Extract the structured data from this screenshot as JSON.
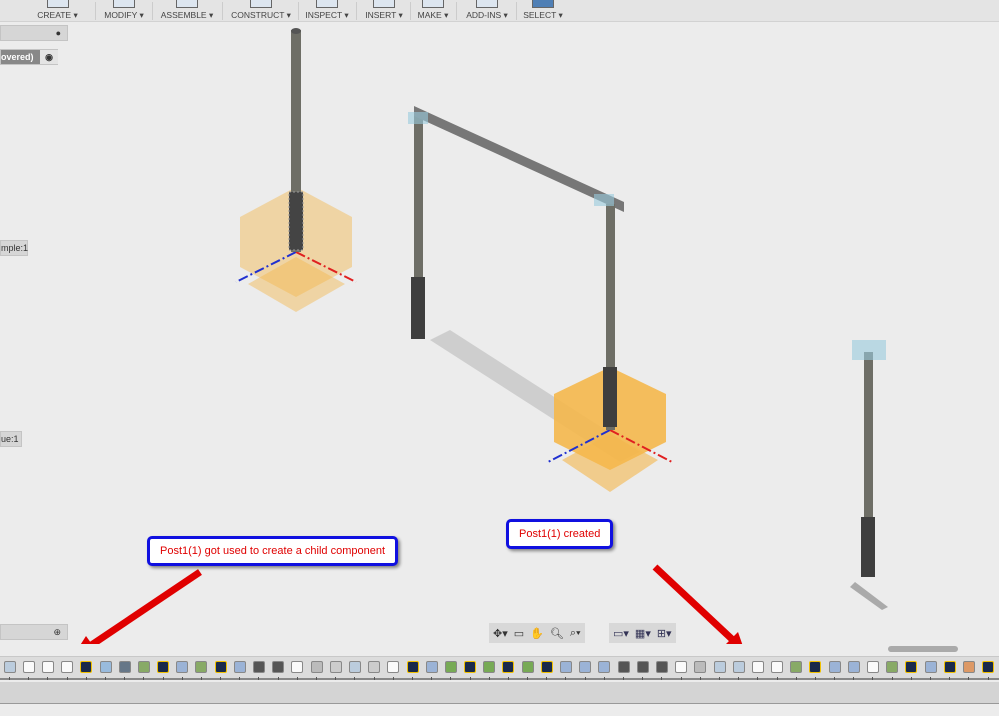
{
  "toolbar": {
    "groups": [
      {
        "label": "CREATE ▾"
      },
      {
        "label": "MODIFY ▾"
      },
      {
        "label": "ASSEMBLE ▾"
      },
      {
        "label": "CONSTRUCT ▾"
      },
      {
        "label": "INSPECT ▾"
      },
      {
        "label": "INSERT ▾"
      },
      {
        "label": "MAKE ▾"
      },
      {
        "label": "ADD-INS ▾"
      },
      {
        "label": "SELECT ▾"
      }
    ]
  },
  "browser": {
    "top_panel": "",
    "row1": "overed)",
    "item2": "mple:1",
    "item3": "ue:1",
    "bottom_panel": ""
  },
  "callouts": {
    "left": "Post1(1) got used to create a child component",
    "right": "Post1(1) created"
  },
  "navbar": {
    "icons": [
      "orbit-icon",
      "look-at-icon",
      "pan-icon",
      "zoom-icon",
      "fit-icon",
      "display-icon",
      "grid-icon",
      "viewports-icon"
    ]
  },
  "colors": {
    "callout_border": "#1010e0",
    "callout_text": "#e00000",
    "arrow": "#e00000",
    "plane": "#f5b84d"
  },
  "timeline": [
    "combine",
    "box",
    "box",
    "box",
    "sketch",
    "hole",
    "shell",
    "split",
    "sketch",
    "extrude",
    "split",
    "sketch",
    "extrude",
    "thread",
    "thread",
    "box",
    "chamfer",
    "joint",
    "combine",
    "joint",
    "box",
    "sketch",
    "extrude",
    "sweep",
    "sketch",
    "sweep",
    "sketch",
    "sweep",
    "sketch",
    "extrude",
    "extrude",
    "extrude",
    "thread",
    "thread",
    "thread",
    "box",
    "chamfer",
    "combine",
    "combine",
    "box",
    "box",
    "split",
    "sketch",
    "extrude",
    "extrude",
    "box",
    "split",
    "sketch",
    "extrude",
    "sketch",
    "appearance",
    "sketch"
  ]
}
